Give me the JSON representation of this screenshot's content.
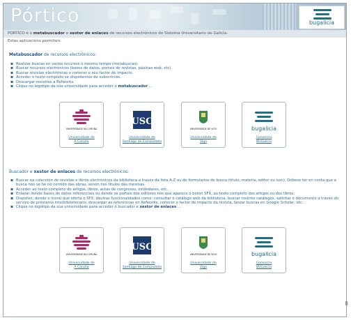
{
  "header": {
    "title": "Pórtico",
    "brand_logo": "bugalicia"
  },
  "subheader": {
    "prefix": "PORTICO é o",
    "bold1": "metabuscador",
    "join": " e ",
    "bold2": "xestor de enlaces",
    "suffix": " de recursos electrónicos do Sistema Universitario de Galicia."
  },
  "intro": "Estas aplicacions permiten:",
  "metabuscador": {
    "heading_bold": "Metabuscador",
    "heading_rest": " de recursos electrónicos:",
    "items": [
      "Realizar buscas en varios recursos ó mesmo tempo (metabuscas).",
      "Buscar recursos electrónicos (bases de datos, portais de revistas, páxinas web, etc).",
      "Buscar revistas electrónicas e coñecer o seu factor de impacto.",
      "Acceder ó texto completo se dispoñemos de subscrición.",
      "Descargar rexistros a Refworks."
    ],
    "last_item_prefix": "Clique no logotipo da súa universidade para acceder ó ",
    "last_item_bold": "metabuscador",
    "last_item_suffix": " ..."
  },
  "xestor": {
    "heading_prefix": "Buscador e ",
    "heading_bold": "xestor de enlaces",
    "heading_rest": " de recursos electrónicos:",
    "items": [
      "Buscar na colección de revistas e libros electrónicos da biblioteca a través da lista A-Z ou de formularios de busca (título, materia, editor ou issn). Débese ter en conta que a busca non se fai no contido das obras, senón nos títulos das mesmas.",
      "Acceder ao texto completo de artigos, libros, actas de congresos, estándares, etc.",
      "Enlazar dende bases de datos referenciais ou dende os portais dos editores nos que aparece o botón SFX, ao texto completo dos artigos ou dos libros.",
      "Dispoñer, dende o menú que oferta o SFX, doutras funcionalidades como: consultar o catálogo web da biblioteca, buscar noutros catálogos, solicitar o documento a través do servizo de préstamo interbibliotecario, descargar as referencias en Refworks, coñecer o factor de impacto da revista, lanzar buscas en Google Scholar, etc."
    ],
    "last_item_prefix": "Clique no logotipo da súa universidade para acceder ó buscador e ",
    "last_item_bold": "xestor de enlaces",
    "last_item_suffix": " ..."
  },
  "universities": [
    {
      "line1": "Universidade de",
      "line2": "A Coruña",
      "emblem_text": "UNIVERSIDADE DA CORUÑA",
      "icon": "udc-logo"
    },
    {
      "line1": "Universidade de",
      "line2": "Santiago de Compostela",
      "emblem_text": "USC",
      "icon": "usc-logo"
    },
    {
      "line1": "Universidade de",
      "line2": "Vigo",
      "emblem_text": "UNIVERSIDADE DE VIGO",
      "icon": "uvigo-logo"
    },
    {
      "line1": "Consorcio",
      "line2": "BUGalicia",
      "emblem_text": "bugalicia",
      "icon": "bugalicia-logo"
    }
  ],
  "colors": {
    "link": "#2a6a9a",
    "udc_magenta": "#b8246a",
    "usc_navy": "#1d3a6e",
    "uvigo_green": "#3a8a4a",
    "bugalicia_teal": "#1f6f86"
  }
}
